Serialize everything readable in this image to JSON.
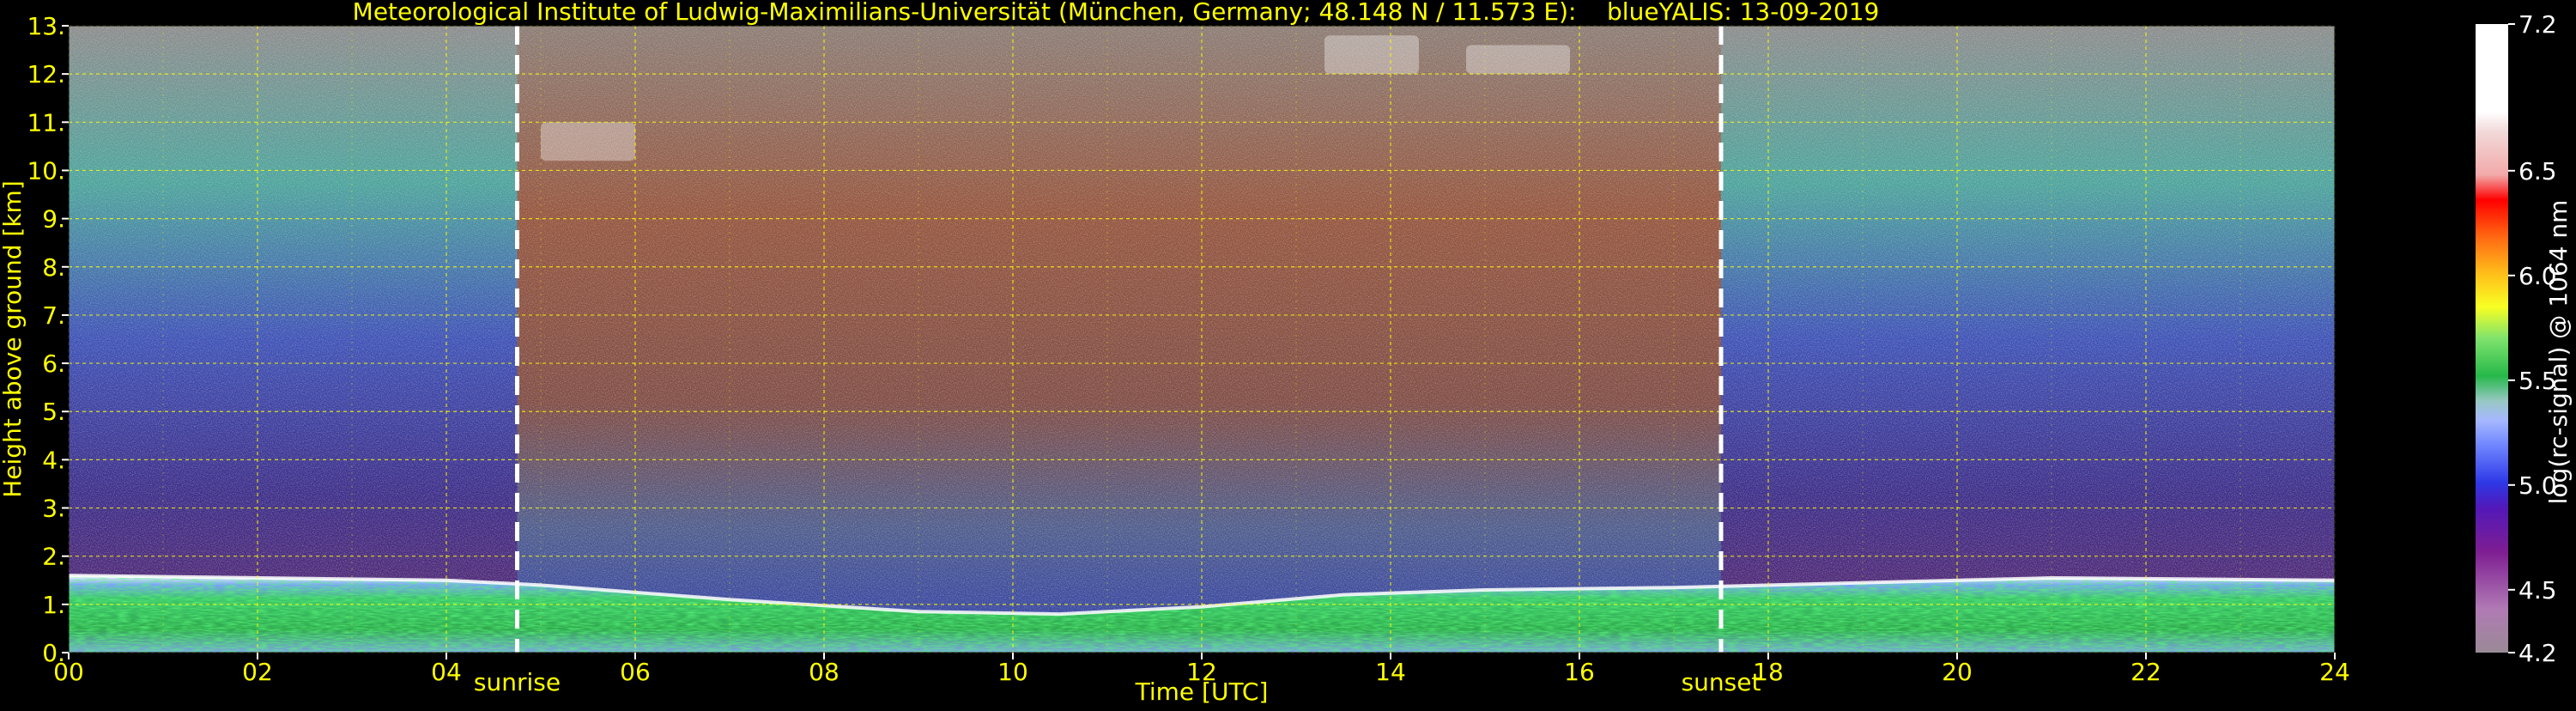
{
  "chart_data": {
    "type": "heatmap",
    "title": "Meteorological Institute of Ludwig-Maximilians-Universität (München, Germany; 48.148 N / 11.573 E):    blueYALIS: 13-09-2019",
    "xlabel": "Time [UTC]",
    "ylabel": "Height above ground [km]",
    "xlim": [
      0,
      24
    ],
    "ylim": [
      0,
      13
    ],
    "x_ticks": [
      "00",
      "02",
      "04",
      "06",
      "08",
      "10",
      "12",
      "14",
      "16",
      "18",
      "20",
      "22",
      "24"
    ],
    "y_ticks": [
      "0.",
      "1.",
      "2.",
      "3.",
      "4.",
      "5.",
      "6.",
      "7.",
      "8.",
      "9.",
      "10.",
      "11.",
      "12.",
      "13."
    ],
    "grid": true,
    "annotations": [
      {
        "label": "sunrise",
        "x": 4.75
      },
      {
        "label": "sunset",
        "x": 17.5
      }
    ],
    "colorbar": {
      "label": "log(rc-signal) @ 1064 nm",
      "range": [
        4.2,
        7.2
      ],
      "ticks": [
        "4.2",
        "4.5",
        "5.0",
        "5.5",
        "6.0",
        "6.5",
        "7.2"
      ]
    },
    "boundary_layer_top_km": [
      [
        0,
        1.6
      ],
      [
        4,
        1.5
      ],
      [
        5,
        1.4
      ],
      [
        7,
        1.1
      ],
      [
        9,
        0.85
      ],
      [
        10.5,
        0.8
      ],
      [
        12,
        0.95
      ],
      [
        13.5,
        1.2
      ],
      [
        15,
        1.3
      ],
      [
        17,
        1.35
      ],
      [
        19,
        1.45
      ],
      [
        21,
        1.55
      ],
      [
        24,
        1.5
      ]
    ],
    "cloud_features": [
      {
        "x": [
          5.0,
          6.0
        ],
        "y": [
          10.2,
          11.0
        ]
      },
      {
        "x": [
          13.3,
          14.3
        ],
        "y": [
          12.0,
          12.8
        ]
      },
      {
        "x": [
          14.8,
          15.9
        ],
        "y": [
          12.0,
          12.6
        ]
      }
    ],
    "colors": {
      "text": "#ffff00",
      "grid": "#ffff00",
      "background": "#000000"
    }
  }
}
